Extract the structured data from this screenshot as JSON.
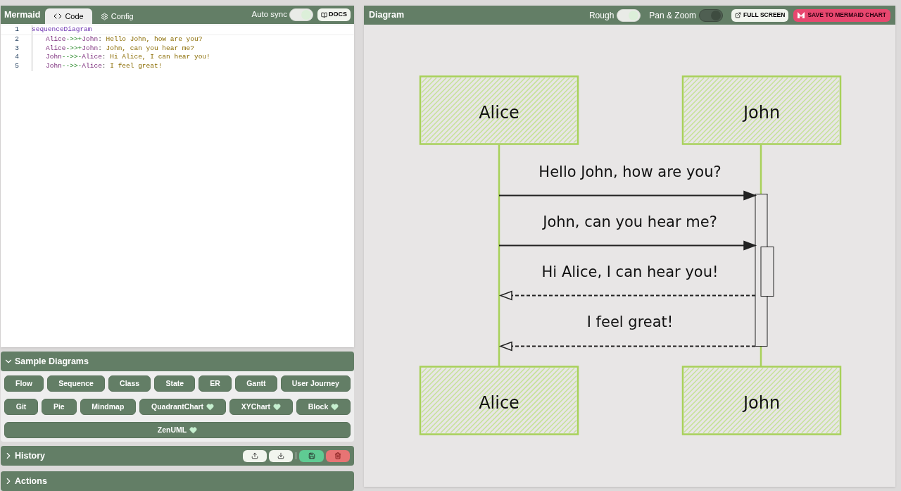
{
  "editor": {
    "title": "Mermaid",
    "tabs": [
      {
        "label": "Code",
        "kind": "code",
        "selected": true
      },
      {
        "label": "Config",
        "kind": "config",
        "selected": false
      }
    ],
    "auto_sync": {
      "label": "Auto sync",
      "on": true
    },
    "docs_button": "DOCS",
    "lines": [
      {
        "number": "1",
        "indent": false,
        "tokens": [
          {
            "text": "sequenceDiagram",
            "kind": "keyword"
          }
        ]
      },
      {
        "number": "2",
        "indent": true,
        "tokens": [
          {
            "text": "Alice",
            "kind": "actor"
          },
          {
            "text": "->>+",
            "kind": "arrow"
          },
          {
            "text": "John",
            "kind": "actor"
          },
          {
            "text": ":",
            "kind": "punct"
          },
          {
            "text": " Hello John, how are you?",
            "kind": "message"
          }
        ]
      },
      {
        "number": "3",
        "indent": true,
        "tokens": [
          {
            "text": "Alice",
            "kind": "actor"
          },
          {
            "text": "->>+",
            "kind": "arrow"
          },
          {
            "text": "John",
            "kind": "actor"
          },
          {
            "text": ":",
            "kind": "punct"
          },
          {
            "text": " John, can you hear me?",
            "kind": "message"
          }
        ]
      },
      {
        "number": "4",
        "indent": true,
        "tokens": [
          {
            "text": "John",
            "kind": "actor"
          },
          {
            "text": "-->>-",
            "kind": "arrow"
          },
          {
            "text": "Alice",
            "kind": "actor"
          },
          {
            "text": ":",
            "kind": "punct"
          },
          {
            "text": " Hi Alice, I can hear you!",
            "kind": "message"
          }
        ]
      },
      {
        "number": "5",
        "indent": true,
        "tokens": [
          {
            "text": "John",
            "kind": "actor"
          },
          {
            "text": "-->>-",
            "kind": "arrow"
          },
          {
            "text": "Alice",
            "kind": "actor"
          },
          {
            "text": ":",
            "kind": "punct"
          },
          {
            "text": " I feel great!",
            "kind": "message"
          }
        ]
      }
    ]
  },
  "sample_diagrams": {
    "title": "Sample Diagrams",
    "expanded": true,
    "buttons": [
      {
        "label": "Flow",
        "heart": false
      },
      {
        "label": "Sequence",
        "heart": false
      },
      {
        "label": "Class",
        "heart": false
      },
      {
        "label": "State",
        "heart": false
      },
      {
        "label": "ER",
        "heart": false
      },
      {
        "label": "Gantt",
        "heart": false
      },
      {
        "label": "User Journey",
        "heart": false
      },
      {
        "label": "Git",
        "heart": false
      },
      {
        "label": "Pie",
        "heart": false
      },
      {
        "label": "Mindmap",
        "heart": false
      },
      {
        "label": "QuadrantChart",
        "heart": true
      },
      {
        "label": "XYChart",
        "heart": true
      },
      {
        "label": "Block",
        "heart": true
      },
      {
        "label": "ZenUML",
        "heart": true
      }
    ]
  },
  "history": {
    "title": "History",
    "expanded": false
  },
  "actions": {
    "title": "Actions",
    "expanded": false
  },
  "diagram": {
    "title": "Diagram",
    "rough": {
      "label": "Rough",
      "on": true,
      "disabled": false
    },
    "pan_zoom": {
      "label": "Pan & Zoom",
      "on": true,
      "disabled": true
    },
    "full_screen": "FULL SCREEN",
    "save": "SAVE TO MERMAID CHART",
    "participants": [
      "Alice",
      "John"
    ],
    "messages": [
      {
        "text": "Hello John, how are you?",
        "kind": "solid"
      },
      {
        "text": "John, can you hear me?",
        "kind": "solid"
      },
      {
        "text": "Hi Alice, I can hear you!",
        "kind": "dashed"
      },
      {
        "text": "I feel great!",
        "kind": "dashed"
      }
    ],
    "bottom_participants": [
      "Alice",
      "John"
    ]
  }
}
